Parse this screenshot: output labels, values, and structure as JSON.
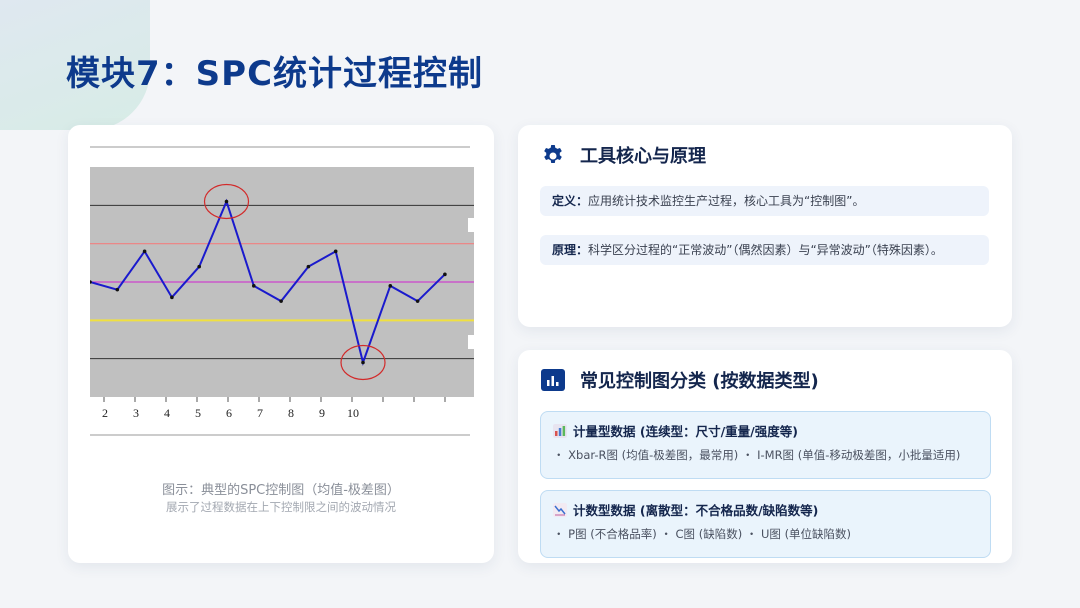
{
  "page": {
    "title": "模块7：SPC统计过程控制"
  },
  "chart_panel": {
    "caption_title": "图示：典型的SPC控制图（均值-极差图）",
    "caption_subtitle": "展示了过程数据在上下控制限之间的波动情况"
  },
  "chart_data": {
    "type": "line",
    "x_tick_labels": [
      "2",
      "3",
      "4",
      "5",
      "6",
      "7",
      "8",
      "9",
      "10"
    ],
    "series": [
      {
        "values": [
          3.0,
          2.8,
          3.8,
          2.6,
          3.4,
          5.1,
          2.9,
          2.5,
          3.4,
          3.8,
          0.9,
          2.9,
          2.5,
          3.2
        ]
      }
    ],
    "reference_lines": {
      "ucl": 4.0,
      "center": 3.0,
      "lcl": 2.0
    },
    "circled_points": [
      5,
      10
    ],
    "colors": {
      "line": "#1a1acd",
      "ucl": "#f08080",
      "center": "#cc44cc",
      "lcl": "#f0e040",
      "plot_bg": "#c0c0c0",
      "circle": "#d22a2a"
    }
  },
  "principle_card": {
    "icon": "gear-icon",
    "heading": "工具核心与原理",
    "definition_label": "定义：",
    "definition_text": "应用统计技术监控生产过程，核心工具为“控制图”。",
    "principle_label": "原理：",
    "principle_text": "科学区分过程的“正常波动”（偶然因素）与“异常波动”（特殊因素）。"
  },
  "types_card": {
    "icon": "bar-chart-icon",
    "heading": "常见控制图分类 (按数据类型)",
    "groups": [
      {
        "icon": "bar-chart-emoji-icon",
        "title": "计量型数据 (连续型：尺寸/重量/强度等)",
        "items": "・ Xbar-R图 (均值-极差图，最常用) ・ I-MR图 (单值-移动极差图，小批量适用)"
      },
      {
        "icon": "trend-down-emoji-icon",
        "title": "计数型数据 (离散型：不合格品数/缺陷数等)",
        "items": "・ P图 (不合格品率) ・ C图 (缺陷数) ・ U图 (单位缺陷数)"
      }
    ]
  }
}
